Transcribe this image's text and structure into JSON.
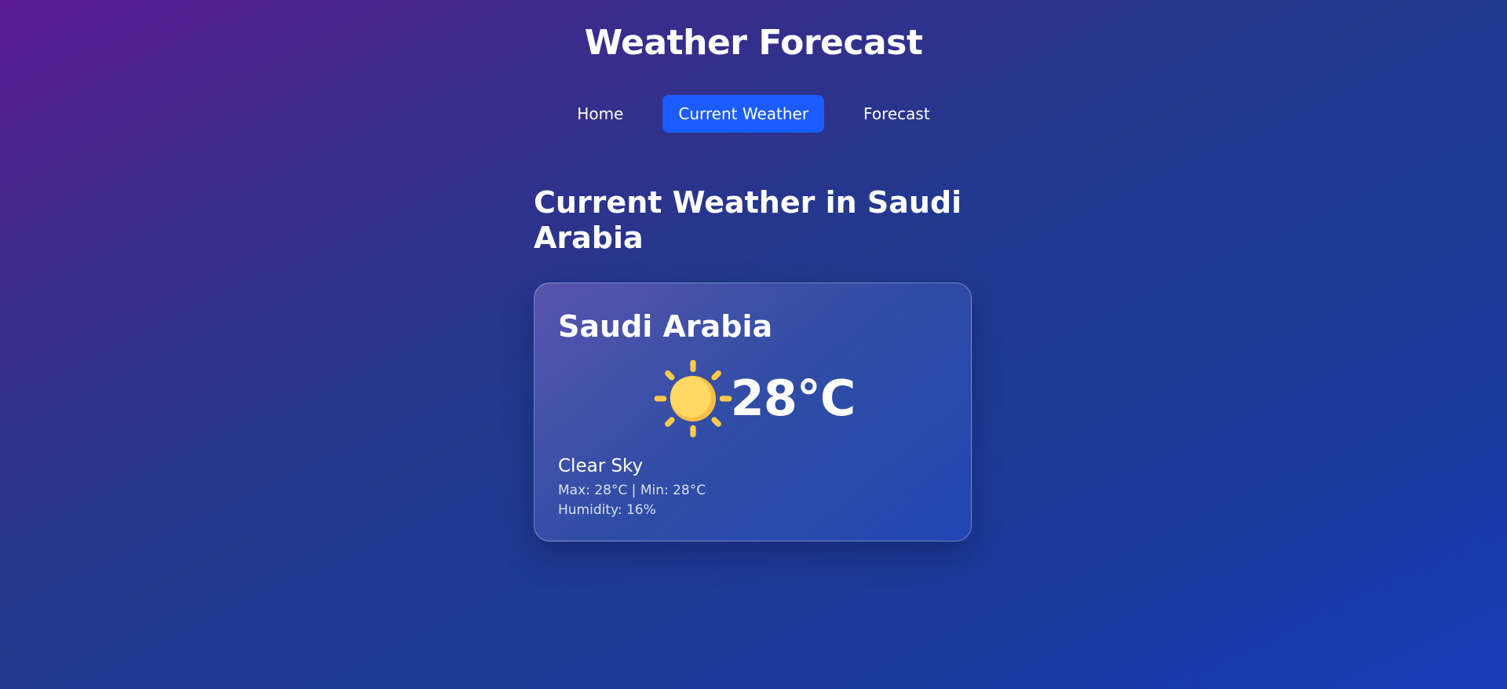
{
  "header": {
    "title": "Weather Forecast"
  },
  "nav": {
    "items": [
      {
        "label": "Home",
        "active": false
      },
      {
        "label": "Current Weather",
        "active": true
      },
      {
        "label": "Forecast",
        "active": false
      }
    ]
  },
  "main": {
    "heading": "Current Weather in Saudi Arabia",
    "card": {
      "city": "Saudi Arabia",
      "icon": "sun-icon",
      "temperature": "28°C",
      "condition": "Clear Sky",
      "max_min": "Max: 28°C | Min: 28°C",
      "humidity": "Humidity: 16%"
    }
  },
  "colors": {
    "nav_active_bg": "#1a5cff",
    "sun_fill": "#ffd25e",
    "sun_shade": "#f7be45"
  }
}
